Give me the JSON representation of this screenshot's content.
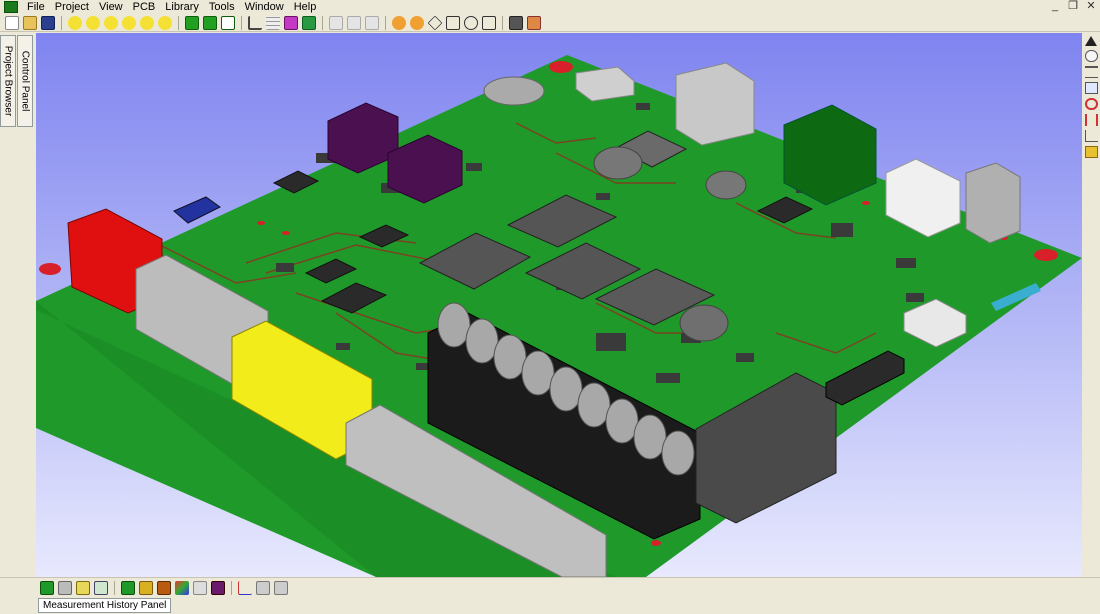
{
  "menubar": {
    "items": [
      "File",
      "Project",
      "View",
      "PCB",
      "Library",
      "Tools",
      "Window",
      "Help"
    ]
  },
  "window_controls": {
    "minimize": "_",
    "restore": "❐",
    "close": "✕"
  },
  "left_tabs": {
    "project_browser": "Project Browser",
    "control_panel": "Control Panel"
  },
  "status": {
    "measurement_panel": "Measurement History Panel"
  },
  "colors": {
    "board": "#1f9a2a",
    "background_top": "#7f84f0",
    "background_bottom": "#e8e9fe",
    "connector_red": "#e01010",
    "connector_yellow": "#f2ec1a",
    "connector_gray": "#b8b8b8",
    "ic_dark": "#2a2a2a",
    "inductor_purple": "#4a1050",
    "rj45_green": "#0e6a12"
  },
  "toolbar_icons": [
    "new-icon",
    "open-icon",
    "save-icon",
    "bulb-icon",
    "bulb-icon",
    "bulb-icon",
    "bulb-icon",
    "bulb-icon",
    "bulb-icon",
    "cube-icon",
    "cube-icon",
    "cube-icon",
    "axis-icon",
    "grid-icon",
    "layer-icon",
    "layer-icon",
    "copy-icon",
    "copy-icon",
    "copy-icon",
    "zoom-icon",
    "zoom-icon",
    "zoom-icon",
    "zoom-icon",
    "zoom-icon",
    "zoom-icon",
    "camera-icon",
    "export-icon"
  ],
  "right_tools": [
    "pointer-icon",
    "pan-icon",
    "ruler-icon",
    "monitor-icon",
    "rotate-icon",
    "measure-icon",
    "angle-icon",
    "probe-icon"
  ],
  "bottom_tools": [
    "board-icon",
    "copper-icon",
    "silk-icon",
    "mask-icon",
    "component-icon",
    "pad-icon",
    "via-icon",
    "net-icon",
    "paste-icon",
    "mech-icon",
    "axis-icon",
    "snap-icon",
    "view-icon"
  ]
}
